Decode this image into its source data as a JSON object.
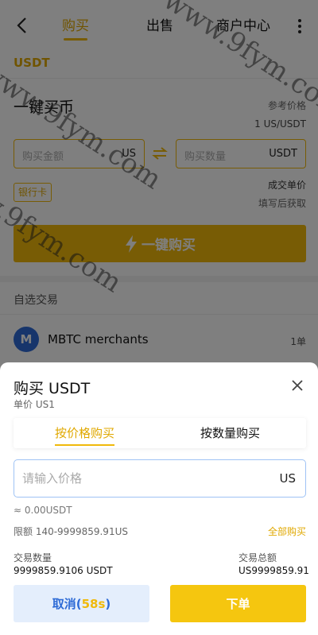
{
  "header": {
    "tabs": [
      {
        "label": "购买",
        "active": true
      },
      {
        "label": "出售",
        "active": false
      },
      {
        "label": "商户中心",
        "active": false
      }
    ]
  },
  "coin": "USDT",
  "onekey": {
    "title": "一键买币",
    "ref_price_label": "参考价格",
    "ref_price_value": "1 US/USDT",
    "amount_placeholder": "购买金额",
    "amount_unit": "US",
    "qty_placeholder": "购买数量",
    "qty_unit": "USDT",
    "payment_tag": "银行卡",
    "deal_price_label": "成交单价",
    "deal_price_hint": "填写后获取",
    "button_label": "一键购买"
  },
  "market": {
    "section_title": "自选交易",
    "merchant": {
      "avatar_letter": "M",
      "name": "MBTC merchants",
      "orders": "1单"
    }
  },
  "sheet": {
    "title": "购买 USDT",
    "unit_price": "单价 US1",
    "mode_tabs": [
      {
        "label": "按价格购买",
        "active": true
      },
      {
        "label": "按数量购买",
        "active": false
      }
    ],
    "price_placeholder": "请输入价格",
    "price_unit": "US",
    "approx": "≈ 0.00USDT",
    "limit": "限额 140-9999859.91US",
    "buy_all": "全部购买",
    "qty_label": "交易数量",
    "qty_value": "9999859.9106 USDT",
    "total_label": "交易总额",
    "total_value": "US9999859.91",
    "cancel_label": "取消(",
    "countdown": "58s",
    "cancel_suffix": ")",
    "order_label": "下单"
  },
  "watermark": {
    "text": "www.9fym.com"
  },
  "colors": {
    "accent": "#f0b90b",
    "blue": "#2e6bd6"
  }
}
